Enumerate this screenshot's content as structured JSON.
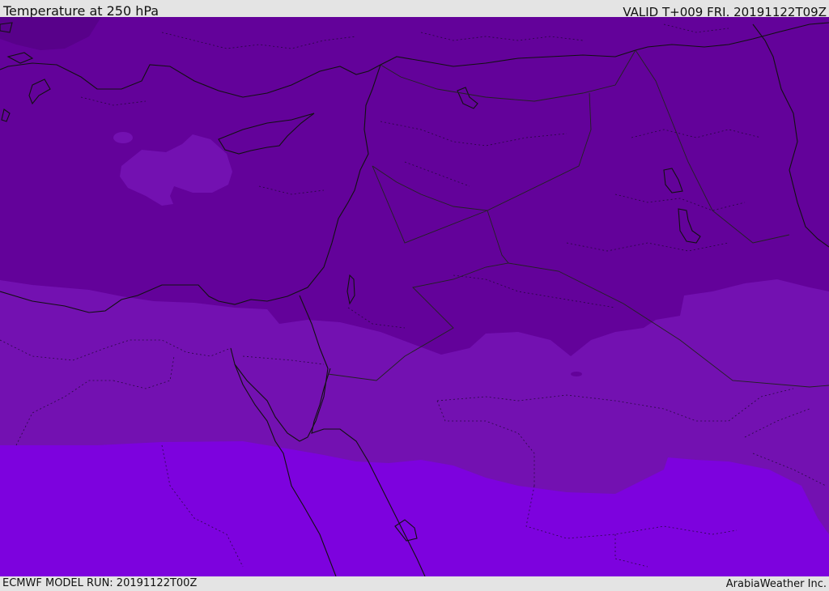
{
  "header": {
    "title": "Temperature at 250 hPa",
    "valid": "VALID T+009 FRI. 20191122T09Z"
  },
  "footer": {
    "model_run": "ECMWF MODEL RUN: 20191122T00Z",
    "credit": "ArabiaWeather Inc."
  },
  "colors": {
    "band_coldest": "#63029a",
    "band_cold": "#7311b1",
    "band_warm": "#7d02de",
    "coastline": "#111111",
    "border": "#222222"
  }
}
